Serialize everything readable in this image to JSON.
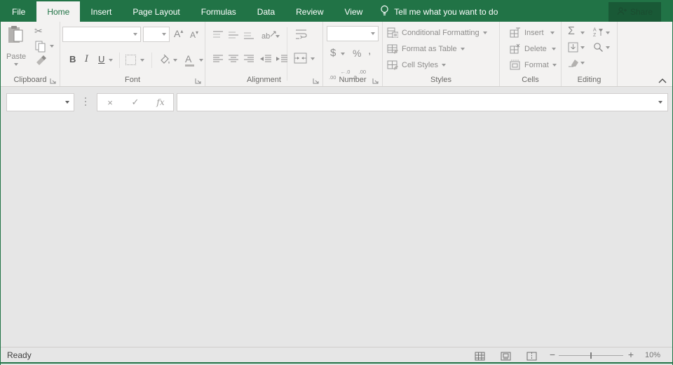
{
  "colors": {
    "accent": "#217346"
  },
  "menu_bar": {
    "tabs": [
      "File",
      "Home",
      "Insert",
      "Page Layout",
      "Formulas",
      "Data",
      "Review",
      "View"
    ],
    "tell_me": "Tell me what you want to do",
    "share": "Share"
  },
  "ribbon": {
    "clipboard": {
      "group_label": "Clipboard",
      "paste_label": "Paste"
    },
    "font": {
      "group_label": "Font",
      "font_name_value": "",
      "font_size_value": "",
      "bold": "B",
      "italic": "I",
      "underline": "U",
      "grow_font": "A",
      "shrink_font": "A",
      "font_color": "A"
    },
    "alignment": {
      "group_label": "Alignment",
      "orientation_glyph": "ab"
    },
    "number": {
      "group_label": "Number",
      "format_value": "",
      "currency": "$",
      "percent": "%",
      "comma": ",",
      "increase_decimal_top": "←.0",
      "increase_decimal_bottom": ".00",
      "decrease_decimal_top": ".00",
      "decrease_decimal_bottom": "→.0"
    },
    "styles": {
      "group_label": "Styles",
      "conditional_formatting": "Conditional Formatting",
      "format_as_table": "Format as Table",
      "cell_styles": "Cell Styles"
    },
    "cells": {
      "group_label": "Cells",
      "insert": "Insert",
      "delete": "Delete",
      "format": "Format"
    },
    "editing": {
      "group_label": "Editing",
      "autosum_glyph": "Σ",
      "cut_glyph": "✂"
    }
  },
  "formula_bar": {
    "name_box_value": "",
    "cancel_glyph": "×",
    "enter_glyph": "✓",
    "fx_glyph": "fx",
    "formula_value": ""
  },
  "status_bar": {
    "mode": "Ready",
    "zoom_out_glyph": "−",
    "zoom_in_glyph": "+",
    "zoom_level": "10%"
  }
}
